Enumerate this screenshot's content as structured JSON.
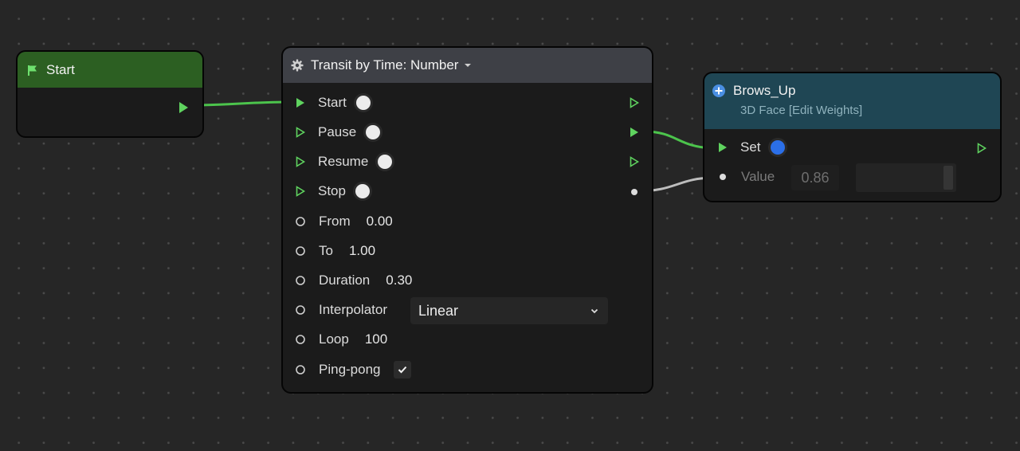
{
  "colors": {
    "canvas": "#262626",
    "flow_port": "#5fd35f",
    "wire_flow": "#4cc44c",
    "wire_value": "#bdbdbd",
    "start_header": "#2c5f22",
    "transit_header": "#3e4046",
    "brows_header": "#1f4654",
    "toggle_blue": "#2b6fe8"
  },
  "start_node": {
    "title": "Start",
    "icon": "flag-icon"
  },
  "transit_node": {
    "title": "Transit by Time: Number",
    "icon": "gear-icon",
    "triggers": [
      {
        "label": "Start"
      },
      {
        "label": "Pause"
      },
      {
        "label": "Resume"
      },
      {
        "label": "Stop"
      }
    ],
    "inputs": {
      "from": {
        "label": "From",
        "value": "0.00"
      },
      "to": {
        "label": "To",
        "value": "1.00"
      },
      "duration": {
        "label": "Duration",
        "value": "0.30"
      },
      "interpolator": {
        "label": "Interpolator",
        "value": "Linear"
      },
      "loop": {
        "label": "Loop",
        "value": "100"
      },
      "pingpong": {
        "label": "Ping-pong",
        "checked": true
      }
    }
  },
  "brows_node": {
    "title": "Brows_Up",
    "subtitle": "3D Face [Edit Weights]",
    "icon": "plus-circle-icon",
    "set_label": "Set",
    "value_label": "Value",
    "value": "0.86",
    "slider_level": 0.86
  }
}
